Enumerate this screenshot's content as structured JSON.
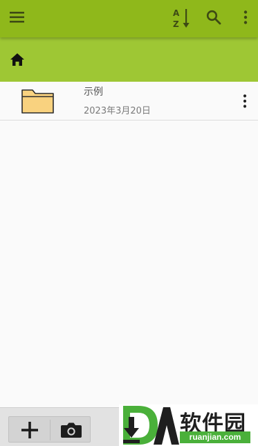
{
  "app_bar": {
    "background": "#8fb81b",
    "icons": [
      "menu-icon",
      "sort-az-icon",
      "search-icon",
      "more-vert-icon"
    ],
    "sort_letters": {
      "top": "A",
      "bottom": "Z"
    }
  },
  "breadcrumb": {
    "background": "#9ec734",
    "home_icon": "home-icon"
  },
  "files": [
    {
      "name": "示例",
      "date": "2023年3月20日",
      "type": "folder",
      "icon_color": "#f9d27f"
    }
  ],
  "bottom_toolbar": {
    "icons": [
      "add-icon",
      "camera-icon"
    ]
  },
  "watermark": {
    "brand": "软件园",
    "url": "ruanjian.com",
    "accent": "#4ab03a"
  }
}
